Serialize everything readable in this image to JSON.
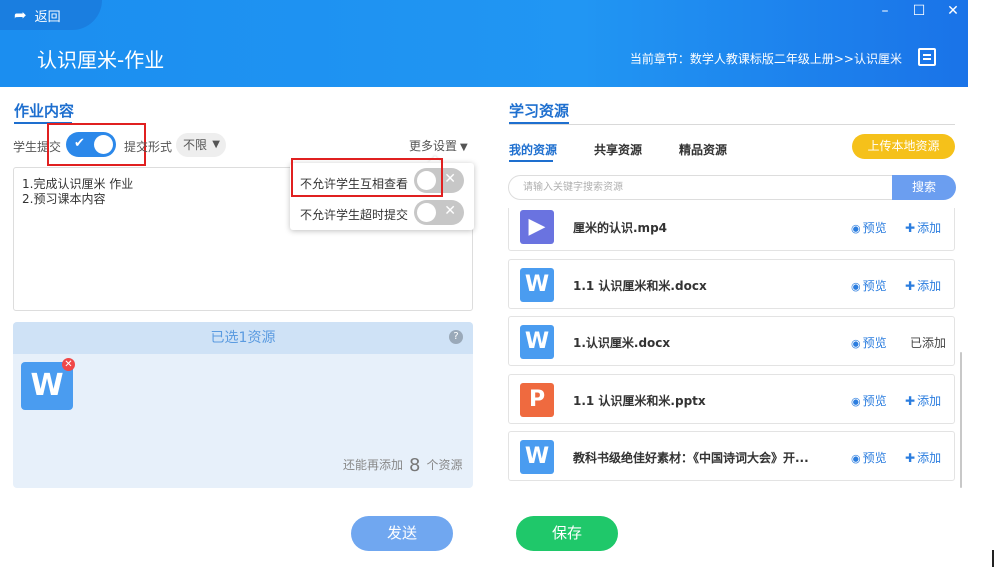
{
  "window": {
    "back_label": "返回",
    "minimize": "–",
    "maximize": "☐",
    "close": "✕"
  },
  "header": {
    "title": "认识厘米-作业",
    "chapter": "当前章节：数学人教课标版二年级上册>>认识厘米"
  },
  "left": {
    "section_title": "作业内容",
    "student_submit_label": "学生提交",
    "student_submit_on": true,
    "submit_form_label": "提交形式",
    "submit_form_value": "不限",
    "more_settings_label": "更多设置",
    "content_lines": [
      "1.完成认识厘米 作业",
      "2.预习课本内容"
    ],
    "settings_menu": [
      {
        "label": "不允许学生互相查看",
        "on": false
      },
      {
        "label": "不允许学生超时提交",
        "on": false
      }
    ],
    "selected": {
      "header": "已选1资源",
      "help": "?",
      "file_letter": "W",
      "remove": "✕",
      "remain_prefix": "还能再添加",
      "remain_count": "8",
      "remain_suffix": "个资源"
    }
  },
  "right": {
    "section_title": "学习资源",
    "tabs": [
      "我的资源",
      "共享资源",
      "精品资源"
    ],
    "upload_label": "上传本地资源",
    "search_placeholder": "请输入关键字搜索资源",
    "search_button": "搜索",
    "preview_label": "预览",
    "add_label": "添加",
    "added_label": "已添加",
    "items": [
      {
        "name": "厘米的认识.mp4",
        "icon": "▶",
        "color": "#6a73e0",
        "added": false
      },
      {
        "name": "1.1 认识厘米和米.docx",
        "icon": "W",
        "color": "#4a9cf0",
        "added": false
      },
      {
        "name": "1.认识厘米.docx",
        "icon": "W",
        "color": "#4a9cf0",
        "added": true
      },
      {
        "name": "1.1 认识厘米和米.pptx",
        "icon": "P",
        "color": "#ef6a3f",
        "added": false
      },
      {
        "name": "教科书级绝佳好素材：《中国诗词大会》开...",
        "icon": "W",
        "color": "#4a9cf0",
        "added": false
      }
    ]
  },
  "footer": {
    "send": "发送",
    "save": "保存"
  }
}
